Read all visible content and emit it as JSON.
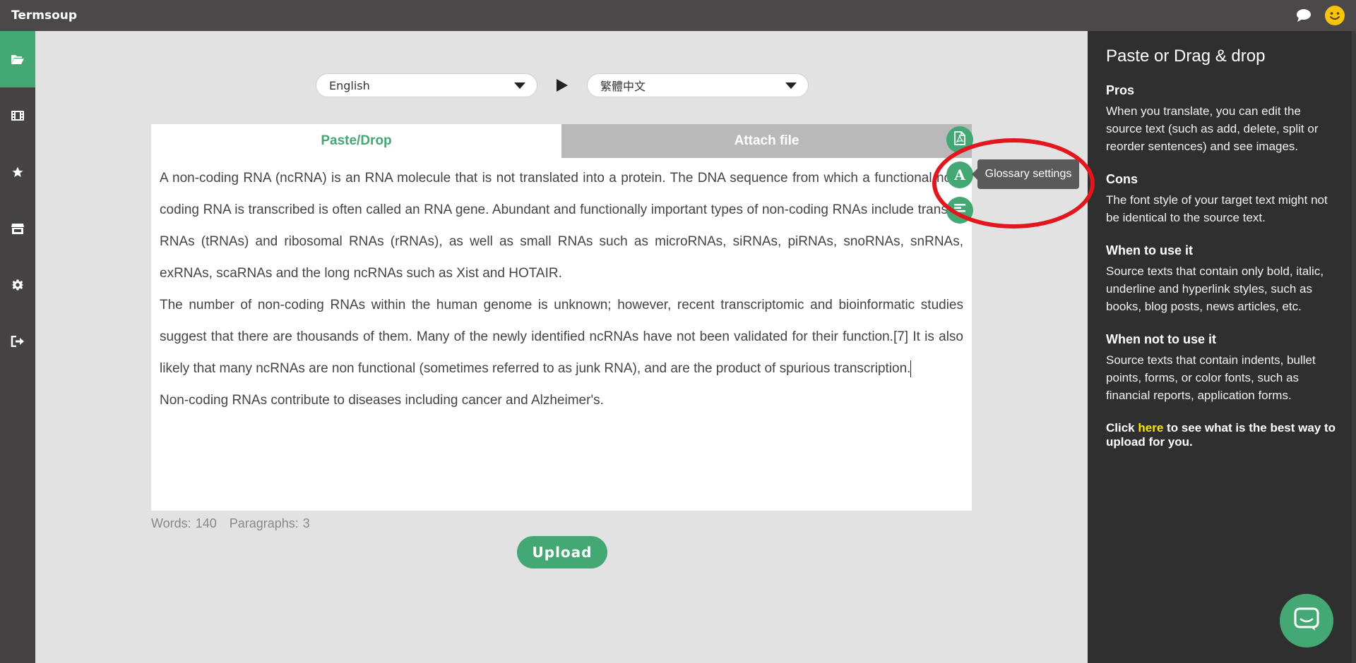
{
  "app": {
    "title": "Termsoup"
  },
  "icons": {
    "chat": "chat-bubble-icon",
    "profile": "smiley-icon",
    "sidebar": [
      "folder-open-icon",
      "film-icon",
      "star-icon",
      "store-icon",
      "gear-icon",
      "sign-out-icon"
    ]
  },
  "languages": {
    "source": "English",
    "target": "繁體中文"
  },
  "tabs": [
    {
      "label": "Paste/Drop",
      "active": true
    },
    {
      "label": "Attach file",
      "active": false
    }
  ],
  "content": {
    "paragraphs": [
      "A non-coding RNA (ncRNA) is an RNA molecule that is not translated into a protein. The DNA sequence from which a functional non-coding RNA is transcribed is often called an RNA gene. Abundant and functionally important types of non-coding RNAs include transfer RNAs (tRNAs) and ribosomal RNAs (rRNAs), as well as small RNAs such as microRNAs, siRNAs, piRNAs, snoRNAs, snRNAs, exRNAs, scaRNAs and the long ncRNAs such as Xist and HOTAIR.",
      "The number of non-coding RNAs within the human genome is unknown; however, recent transcriptomic and bioinformatic studies suggest that there are thousands of them. Many of the newly identified ncRNAs have not been validated for their function.[7] It is also likely that many ncRNAs are non functional (sometimes referred to as junk RNA), and are the product of spurious transcription.",
      "Non-coding RNAs contribute to diseases including cancer and Alzheimer's."
    ]
  },
  "counts": {
    "words_label": "Words:",
    "words": "140",
    "paragraphs_label": "Paragraphs:",
    "paragraphs": "3"
  },
  "upload": {
    "label": "Upload"
  },
  "tools": {
    "glossary_letter": "A",
    "glossary_tooltip": "Glossary settings"
  },
  "panel": {
    "title": "Paste or Drag & drop",
    "pros_title": "Pros",
    "pros_text": "When you translate, you can edit the source text (such as add, delete, split or reorder sentences) and see images.",
    "cons_title": "Cons",
    "cons_text": "The font style of your target text might not be identical to the source text.",
    "when_title": "When to use it",
    "when_text": "Source texts that contain only bold, italic, underline and hyperlink styles, such as books, blog posts, news articles, etc.",
    "when_not_title": "When not to use it",
    "when_not_text": "Source texts that contain indents, bullet points, forms, or color fonts, such as financial reports, application forms.",
    "click_prefix": "Click",
    "click_link": "here",
    "click_suffix": "to see what is the best way to upload for you."
  },
  "colors": {
    "accent": "#43a874",
    "topbar": "#4a4849",
    "sidebar": "#444243",
    "panel": "#2f2f2f",
    "highlight": "#e3161e",
    "link": "#f7e600"
  }
}
